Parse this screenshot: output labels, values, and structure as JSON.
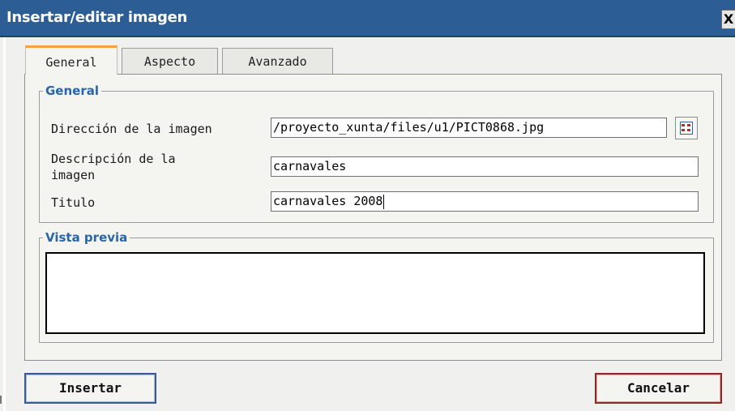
{
  "window": {
    "title": "Insertar/editar imagen",
    "close_glyph": "X"
  },
  "tabs": [
    {
      "label": "General",
      "active": true
    },
    {
      "label": "Aspecto",
      "active": false
    },
    {
      "label": "Avanzado",
      "active": false
    }
  ],
  "general": {
    "legend": "General",
    "fields": [
      {
        "label": "Dirección de la imagen",
        "value": "/proyecto_xunta/files/u1/PICT0868.jpg"
      },
      {
        "label_line1": "Descripción de la",
        "label_line2": "imagen",
        "value": "carnavales"
      },
      {
        "label": "Titulo",
        "value": "carnavales 2008"
      }
    ],
    "browse_icon": "browse-grid-icon"
  },
  "preview": {
    "legend": "Vista previa"
  },
  "buttons": {
    "insert": "Insertar",
    "cancel": "Cancelar"
  },
  "colors": {
    "titlebar": "#2d5d95",
    "legend": "#2b64a8",
    "active_tab_accent": "#f1a33d"
  }
}
